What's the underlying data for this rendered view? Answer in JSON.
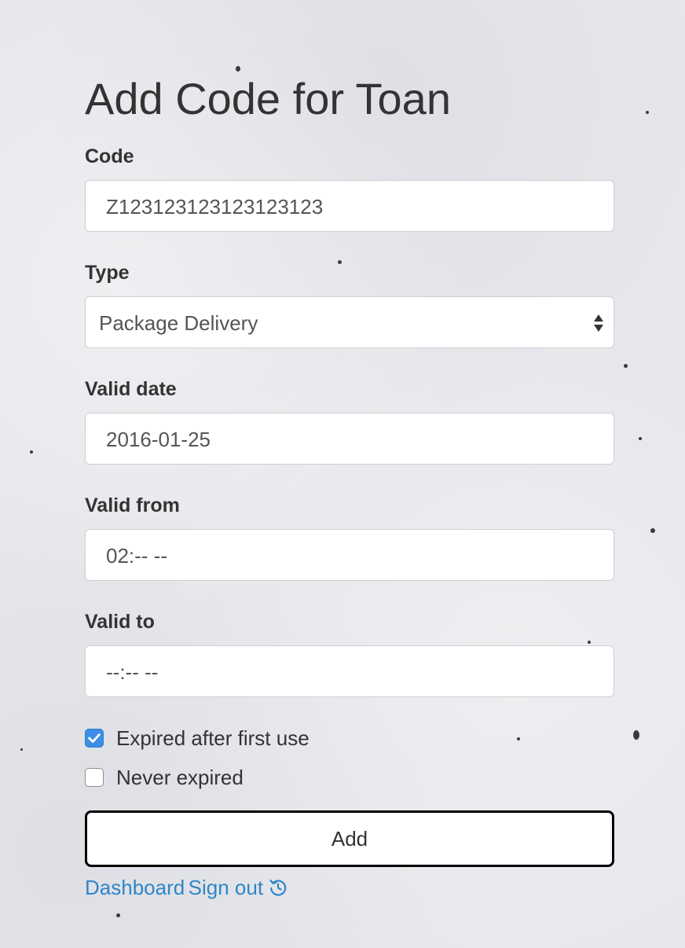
{
  "page": {
    "title": "Add Code for Toan"
  },
  "form": {
    "code": {
      "label": "Code",
      "value": "Z123123123123123123"
    },
    "type": {
      "label": "Type",
      "selected": "Package Delivery"
    },
    "valid_date": {
      "label": "Valid date",
      "value": "2016-01-25"
    },
    "valid_from": {
      "label": "Valid from",
      "value": "02:-- --"
    },
    "valid_to": {
      "label": "Valid to",
      "value": "--:-- --"
    },
    "expired_after_first_use": {
      "label": "Expired after first use",
      "checked": true
    },
    "never_expired": {
      "label": "Never expired",
      "checked": false
    },
    "submit_label": "Add"
  },
  "footer": {
    "dashboard_link": "Dashboard",
    "sign_out_link": "Sign out",
    "sign_out_icon": "history-icon"
  },
  "colors": {
    "background": "#e6e7eb",
    "link": "#2f86c8",
    "checkbox_checked": "#3d8ee6"
  }
}
